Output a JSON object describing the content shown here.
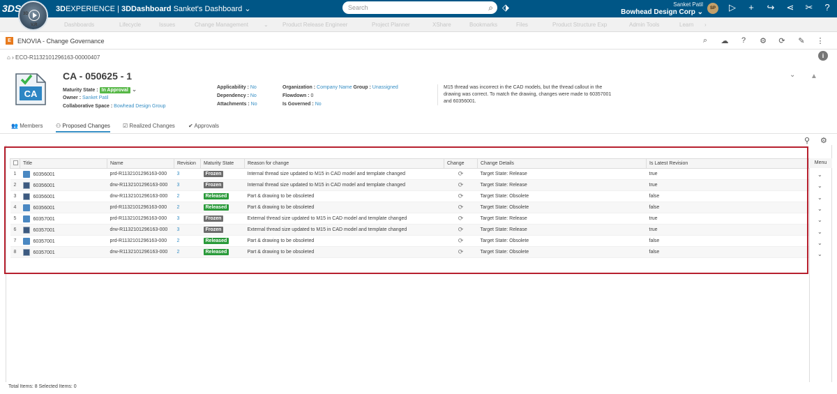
{
  "topbar": {
    "ds_logo": "3DS",
    "compass_3d": "3D",
    "compass_vr": "V,R",
    "brand_prefix": "3D",
    "brand_name": "EXPERIENCE",
    "separator": " | ",
    "brand_app": "3DDashboard",
    "dashboard_name": "Sanket's Dashboard",
    "dashboard_chevron": "⌄",
    "search_placeholder": "Search",
    "user_name": "Sanket Patil",
    "company": "Bowhead Design Corp",
    "company_chevron": "⌄",
    "avatar_initials": "SP"
  },
  "dashboard_tabs": [
    "Dashboards",
    "Lifecycle",
    "Issues",
    "Change Management",
    "⌄",
    "Product Release Engineer",
    "Project Planner",
    "XShare",
    "Bookmarks",
    "Files",
    "Product Structure Exp",
    "Admin Tools",
    "Learn",
    "›"
  ],
  "app": {
    "title": "ENOVIA - Change Governance",
    "logo_letter": "E"
  },
  "breadcrumb": "ECO-R1132101296163-00000407",
  "change_action": {
    "icon_label": "CA",
    "title": "CA - 050625 - 1",
    "maturity_label": "Maturity State :",
    "maturity_value": "In Approval",
    "owner_label": "Owner :",
    "owner_value": "Sanket Patil",
    "collab_label": "Collaborative Space :",
    "collab_value": "Bowhead Design Group",
    "applicability_label": "Applicability :",
    "applicability_value": "No",
    "dependency_label": "Dependency :",
    "dependency_value": "No",
    "attachments_label": "Attachments :",
    "attachments_value": "No",
    "organization_label": "Organization :",
    "organization_value": "Company Name",
    "group_label": "Group :",
    "group_value": "Unassigned",
    "flowdown_label": "Flowdown :",
    "flowdown_value": "0",
    "governed_label": "Is Governed :",
    "governed_value": "No",
    "description": "M15 thread was incorrect in the CAD models, but the thread callout in the drawing was correct. To match the drawing, changes were made to 60357001 and 60356001."
  },
  "subtabs": {
    "members": "Members",
    "proposed": "Proposed Changes",
    "realized": "Realized Changes",
    "approvals": "Approvals"
  },
  "grid": {
    "columns": [
      "Title",
      "Name",
      "Revision",
      "Maturity State",
      "Reason for change",
      "Change",
      "Change Details",
      "Is Latest Revision"
    ],
    "menu_header": "Menu",
    "rows": [
      {
        "n": "1",
        "kind": "prd",
        "title": "60356001",
        "name": "prd-R1132101296163-000",
        "rev": "3",
        "state": "Frozen",
        "reason": "Internal thread size updated to M15 in CAD model and template changed",
        "details": "Target State: Release",
        "latest": "true"
      },
      {
        "n": "2",
        "kind": "drw",
        "title": "60356001",
        "name": "drw-R1132101296163-000",
        "rev": "3",
        "state": "Frozen",
        "reason": "Internal thread size updated to M15 in CAD model and template changed",
        "details": "Target State: Release",
        "latest": "true"
      },
      {
        "n": "3",
        "kind": "drw",
        "title": "60356001",
        "name": "drw-R1132101296163-000",
        "rev": "2",
        "state": "Released",
        "reason": "Part & drawing to be obsoleted",
        "details": "Target State: Obsolete",
        "latest": "false"
      },
      {
        "n": "4",
        "kind": "prd",
        "title": "60356001",
        "name": "prd-R1132101296163-000",
        "rev": "2",
        "state": "Released",
        "reason": "Part & drawing to be obsoleted",
        "details": "Target State: Obsolete",
        "latest": "false"
      },
      {
        "n": "5",
        "kind": "prd",
        "title": "60357001",
        "name": "prd-R1132101296163-000",
        "rev": "3",
        "state": "Frozen",
        "reason": "External thread size updated to M15 in CAD model and template changed",
        "details": "Target State: Release",
        "latest": "true"
      },
      {
        "n": "6",
        "kind": "drw",
        "title": "60357001",
        "name": "drw-R1132101296163-000",
        "rev": "3",
        "state": "Frozen",
        "reason": "External thread size updated to M15 in CAD model and template changed",
        "details": "Target State: Release",
        "latest": "true"
      },
      {
        "n": "7",
        "kind": "prd",
        "title": "60357001",
        "name": "prd-R1132101296163-000",
        "rev": "2",
        "state": "Released",
        "reason": "Part & drawing to be obsoleted",
        "details": "Target State: Obsolete",
        "latest": "false"
      },
      {
        "n": "8",
        "kind": "drw",
        "title": "60357001",
        "name": "drw-R1132101296163-000",
        "rev": "2",
        "state": "Released",
        "reason": "Part & drawing to be obsoleted",
        "details": "Target State: Obsolete",
        "latest": "false"
      }
    ],
    "change_glyph": "⟳",
    "row_menu_glyph": "⌄"
  },
  "footer": {
    "total": "Total Items: 8",
    "selected": "Selected Items: 0"
  },
  "colors": {
    "topbar": "#005686",
    "link": "#368ec4",
    "frozen": "#6d6d6d",
    "released": "#2a9a3a",
    "in_approval": "#57b847",
    "highlight_box": "#b7202e"
  },
  "icons": {
    "search": "search-icon",
    "tag": "tag-icon",
    "chat": "chat-icon",
    "add": "plus-icon",
    "share": "share-icon",
    "network": "network-icon",
    "tools": "tools-icon",
    "help": "help-icon",
    "home": "home-icon",
    "info": "info-icon"
  }
}
